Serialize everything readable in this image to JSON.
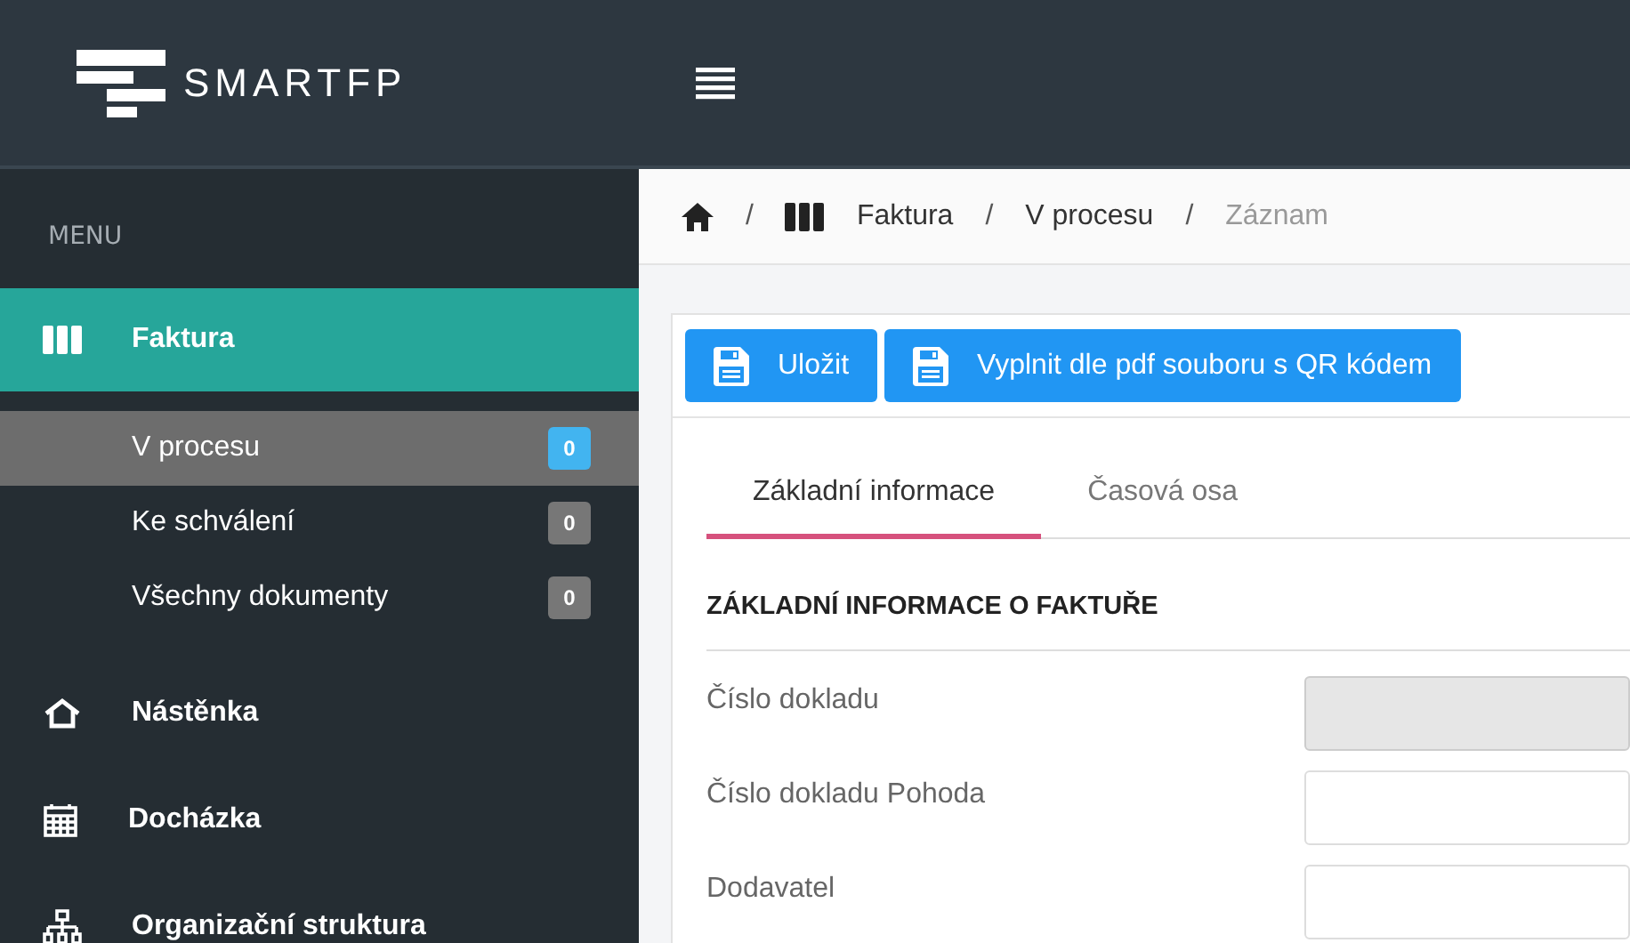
{
  "header": {
    "logo": "SMARTFP"
  },
  "sidebar": {
    "heading": "MENU",
    "items": [
      {
        "label": "Faktura",
        "selected": true,
        "children": [
          {
            "label": "V procesu",
            "count": "0",
            "selected": true
          },
          {
            "label": "Ke schválení",
            "count": "0",
            "selected": false
          },
          {
            "label": "Všechny dokumenty",
            "count": "0",
            "selected": false
          }
        ]
      },
      {
        "label": "Nástěnka",
        "selected": false
      },
      {
        "label": "Docházka",
        "selected": false
      },
      {
        "label": "Organizační struktura",
        "selected": false
      }
    ]
  },
  "breadcrumb": [
    {
      "separator": "/",
      "label": "Faktura"
    },
    {
      "separator": "/",
      "label": "V procesu"
    },
    {
      "separator": "/",
      "label": "Záznam"
    }
  ],
  "toolbar": {
    "buttons": [
      "Uložit",
      "Vyplnit dle pdf souboru s QR kódem"
    ]
  },
  "tabs": [
    {
      "label": "Základní informace",
      "selected": true
    },
    {
      "label": "Časová osa",
      "selected": false
    }
  ],
  "section": {
    "title": "ZÁKLADNÍ INFORMACE O FAKTUŘE",
    "fields": [
      {
        "label": "Číslo dokladu",
        "disabled": true
      },
      {
        "label": "Číslo dokladu Pohoda",
        "disabled": false
      },
      {
        "label": "Dodavatel",
        "disabled": false
      }
    ]
  }
}
